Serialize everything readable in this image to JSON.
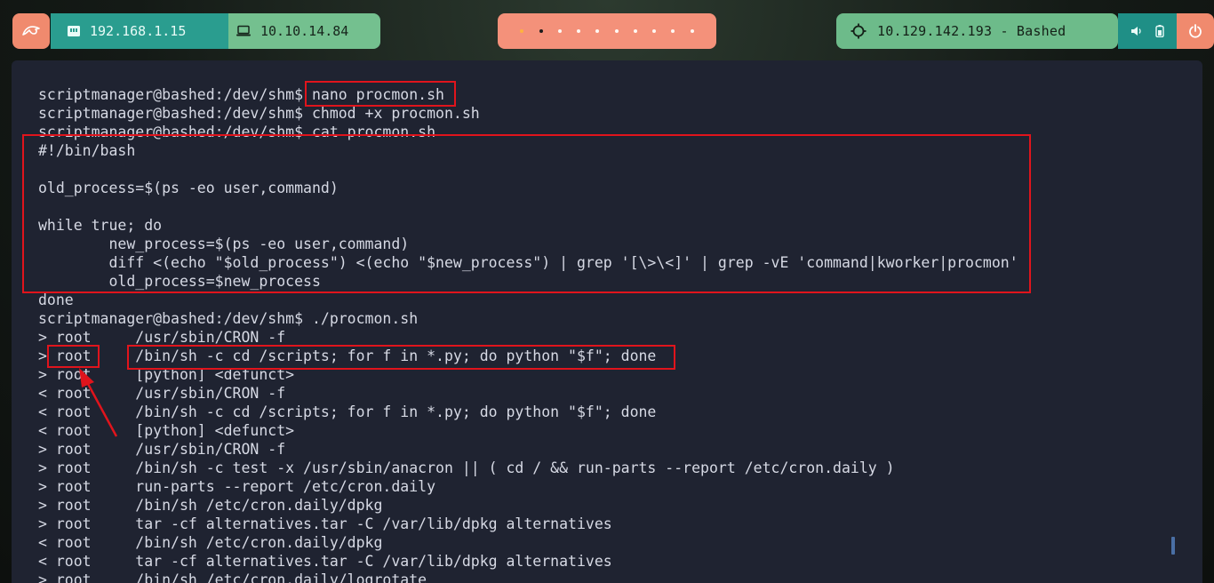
{
  "topbar": {
    "logo_icon": "kali-dragon-icon",
    "network_1": {
      "icon": "ethernet-icon",
      "ip": "192.168.1.15"
    },
    "network_2": {
      "icon": "laptop-icon",
      "ip": "10.10.14.84"
    },
    "workspaces": {
      "count": 10,
      "active_index": 0,
      "current_index": 1
    },
    "target": {
      "icon": "crosshair-icon",
      "label": "10.129.142.193 - Bashed"
    },
    "system_icons": [
      "speaker-icon",
      "battery-icon"
    ],
    "power_icon": "power-icon"
  },
  "terminal": {
    "lines": [
      "scriptmanager@bashed:/dev/shm$ nano procmon.sh",
      "scriptmanager@bashed:/dev/shm$ chmod +x procmon.sh",
      "scriptmanager@bashed:/dev/shm$ cat procmon.sh",
      "#!/bin/bash",
      "",
      "old_process=$(ps -eo user,command)",
      "",
      "while true; do",
      "        new_process=$(ps -eo user,command)",
      "        diff <(echo \"$old_process\") <(echo \"$new_process\") | grep '[\\>\\<]' | grep -vE 'command|kworker|procmon'",
      "        old_process=$new_process",
      "done",
      "scriptmanager@bashed:/dev/shm$ ./procmon.sh",
      "> root     /usr/sbin/CRON -f",
      "> root     /bin/sh -c cd /scripts; for f in *.py; do python \"$f\"; done",
      "> root     [python] <defunct>",
      "< root     /usr/sbin/CRON -f",
      "< root     /bin/sh -c cd /scripts; for f in *.py; do python \"$f\"; done",
      "< root     [python] <defunct>",
      "> root     /usr/sbin/CRON -f",
      "> root     /bin/sh -c test -x /usr/sbin/anacron || ( cd / && run-parts --report /etc/cron.daily )",
      "> root     run-parts --report /etc/cron.daily",
      "> root     /bin/sh /etc/cron.daily/dpkg",
      "> root     tar -cf alternatives.tar -C /var/lib/dpkg alternatives",
      "< root     /bin/sh /etc/cron.daily/dpkg",
      "< root     tar -cf alternatives.tar -C /var/lib/dpkg alternatives",
      "> root     /bin/sh /etc/cron.daily/logrotate"
    ]
  },
  "colors": {
    "terminal_bg": "#1f2331",
    "terminal_fg": "#d6d9e4",
    "highlight": "#e0141c",
    "accent_coral": "#f08a6e",
    "accent_teal": "#2a9d8f",
    "accent_green": "#6dbb8a"
  }
}
